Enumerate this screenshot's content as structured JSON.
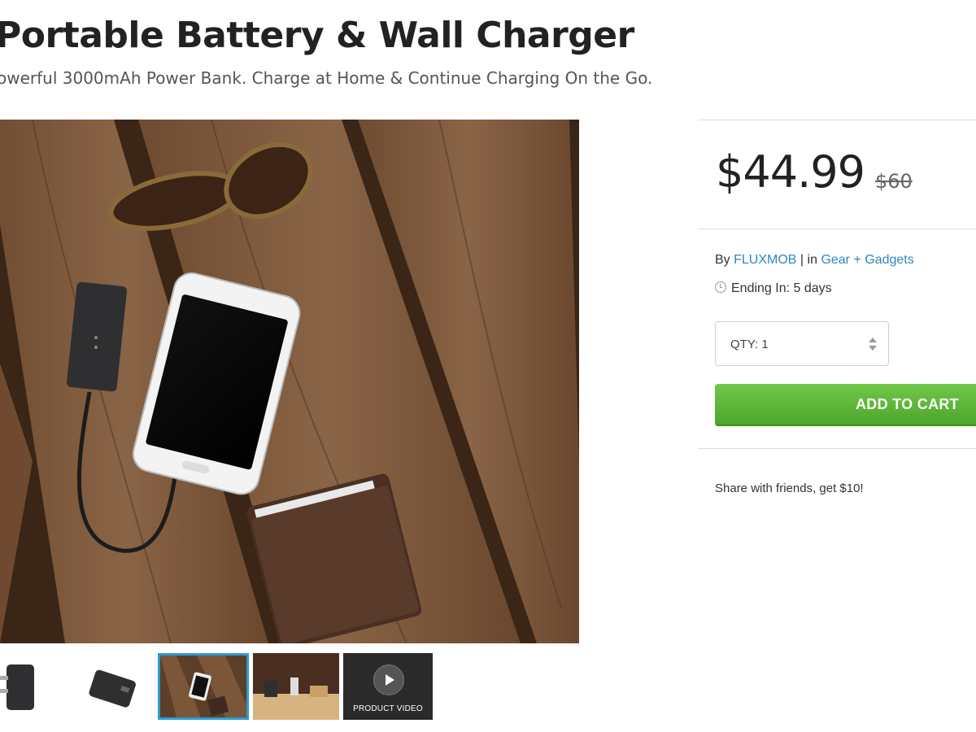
{
  "product": {
    "title": "Portable Battery & Wall Charger",
    "subtitle": "owerful 3000mAh Power Bank. Charge at Home & Continue Charging On the Go."
  },
  "gallery": {
    "video_label": "PRODUCT VIDEO",
    "active_thumb_index": 2
  },
  "purchase": {
    "price": "$44.99",
    "old_price": "$60",
    "by_label": "By",
    "seller": "FLUXMOB",
    "separator": "|",
    "in_label": "in",
    "category": "Gear + Gadgets",
    "ending_label": "Ending In: 5 days",
    "qty_label": "QTY: 1",
    "add_to_cart": "ADD TO CART",
    "share_text": "Share with friends, get $10!"
  },
  "colors": {
    "accent_link": "#2e86c4",
    "cart_green": "#5cb536",
    "thumb_active": "#2c9ad6"
  }
}
